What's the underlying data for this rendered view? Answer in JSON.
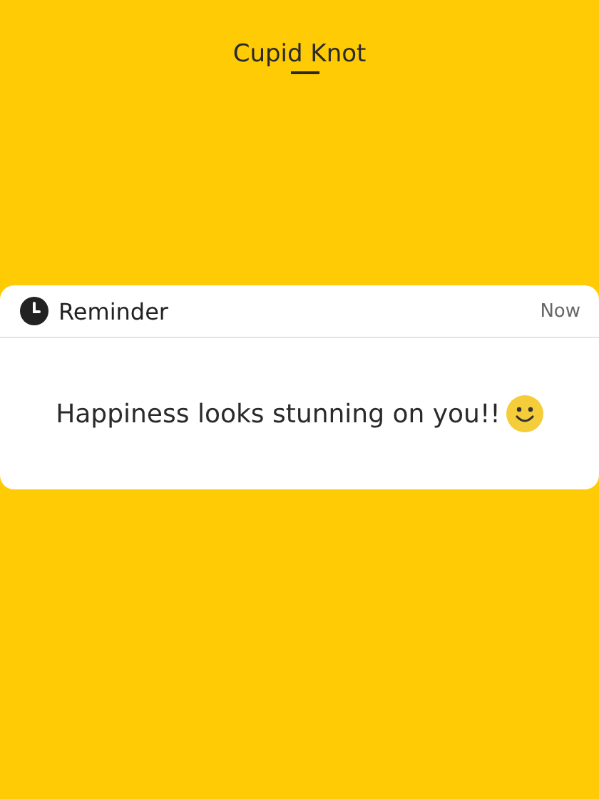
{
  "logo": {
    "text": "Cupid Knot"
  },
  "notification": {
    "app": "Reminder",
    "time": "Now",
    "message": "Happiness looks stunning on you!!"
  }
}
